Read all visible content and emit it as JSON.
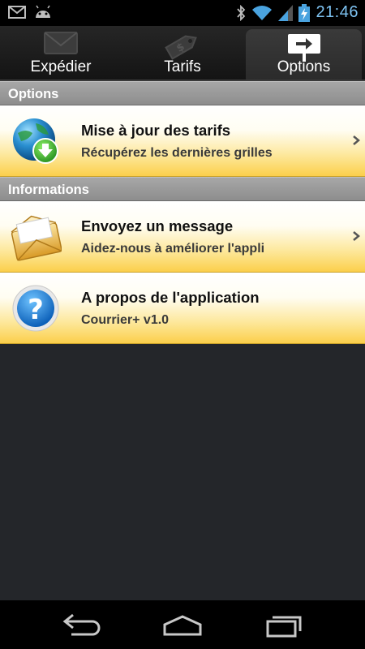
{
  "status_bar": {
    "time": "21:46",
    "left_icons": [
      "gmail-icon",
      "android-icon"
    ],
    "right_icons": [
      "bluetooth-icon",
      "wifi-icon",
      "signal-icon",
      "battery-charging-icon"
    ]
  },
  "tabs": [
    {
      "label": "Expédier",
      "icon": "envelope-icon",
      "selected": false
    },
    {
      "label": "Tarifs",
      "icon": "price-tag-icon",
      "selected": false
    },
    {
      "label": "Options",
      "icon": "signpost-arrow-icon",
      "selected": true
    }
  ],
  "sections": [
    {
      "header": "Options",
      "items": [
        {
          "title": "Mise à jour des tarifs",
          "subtitle": "Récupérez les dernières grilles",
          "icon": "globe-download-icon",
          "chevron": true
        }
      ]
    },
    {
      "header": "Informations",
      "items": [
        {
          "title": "Envoyez un message",
          "subtitle": "Aidez-nous à améliorer l'appli",
          "icon": "envelope-icon",
          "chevron": true
        },
        {
          "title": "A propos de l'application",
          "subtitle": "Courrier+ v1.0",
          "icon": "help-question-icon",
          "chevron": false
        }
      ]
    }
  ],
  "nav_bar": {
    "buttons": [
      "back-icon",
      "home-icon",
      "recent-apps-icon"
    ]
  },
  "colors": {
    "status_accent": "#7ec3f2",
    "row_gradient_bottom": "#fbcf4b",
    "section_header": "#999999",
    "content_background": "#24262a"
  }
}
